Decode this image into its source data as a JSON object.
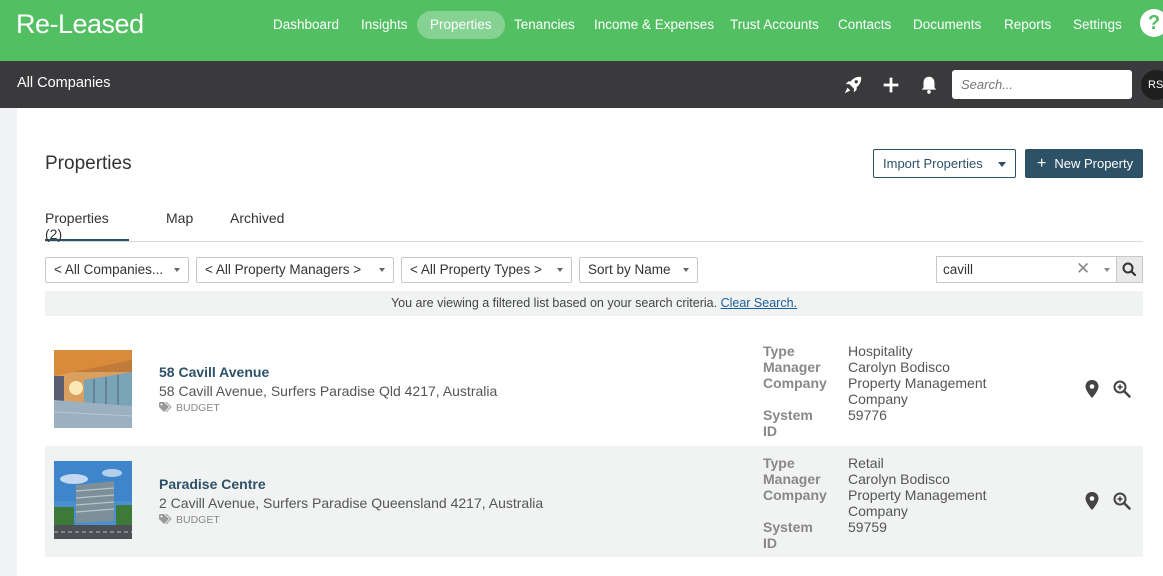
{
  "app": {
    "logo": "Re-Leased"
  },
  "nav": {
    "items": [
      {
        "label": "Dashboard"
      },
      {
        "label": "Insights"
      },
      {
        "label": "Properties"
      },
      {
        "label": "Tenancies"
      },
      {
        "label": "Income & Expenses"
      },
      {
        "label": "Trust Accounts"
      },
      {
        "label": "Contacts"
      },
      {
        "label": "Documents"
      },
      {
        "label": "Reports"
      },
      {
        "label": "Settings"
      }
    ],
    "active": "Properties",
    "help": "?"
  },
  "subbar": {
    "company": "All Companies",
    "search_placeholder": "Search...",
    "avatar": "RS",
    "icons": [
      "rocket-icon",
      "plus-icon",
      "bell-icon"
    ]
  },
  "page": {
    "title": "Properties",
    "import_label": "Import Properties",
    "new_label": "New Property",
    "new_prefix": "+"
  },
  "tabs": [
    {
      "label": "Properties (2)"
    },
    {
      "label": "Map"
    },
    {
      "label": "Archived"
    }
  ],
  "filters": [
    {
      "label": "< All Companies..."
    },
    {
      "label": "< All Property Managers >"
    },
    {
      "label": "< All Property Types >"
    },
    {
      "label": "Sort by Name"
    }
  ],
  "search": {
    "value": "cavill",
    "clear": "✕"
  },
  "notice": {
    "text": "You are viewing a filtered list based on your search criteria.",
    "link": "Clear Search."
  },
  "properties": [
    {
      "name": "58 Cavill Avenue",
      "address": "58 Cavill Avenue, Surfers Paradise Qld 4217, Australia",
      "tag": "BUDGET",
      "labels": {
        "type": "Type",
        "manager": "Manager",
        "company": "Company",
        "system": "System",
        "id": "ID"
      },
      "type": "Hospitality",
      "manager": "Carolyn Bodisco",
      "company_line1": "Property Management",
      "company_line2": "Company",
      "system_id": "59776"
    },
    {
      "name": "Paradise Centre",
      "address": "2 Cavill Avenue, Surfers Paradise Queensland 4217, Australia",
      "tag": "BUDGET",
      "labels": {
        "type": "Type",
        "manager": "Manager",
        "company": "Company",
        "system": "System",
        "id": "ID"
      },
      "type": "Retail",
      "manager": "Carolyn Bodisco",
      "company_line1": "Property Management",
      "company_line2": "Company",
      "system_id": "59759"
    }
  ],
  "colors": {
    "brand": "#52bf63",
    "subbar": "#3a3a3c",
    "accent": "#2d5267"
  }
}
